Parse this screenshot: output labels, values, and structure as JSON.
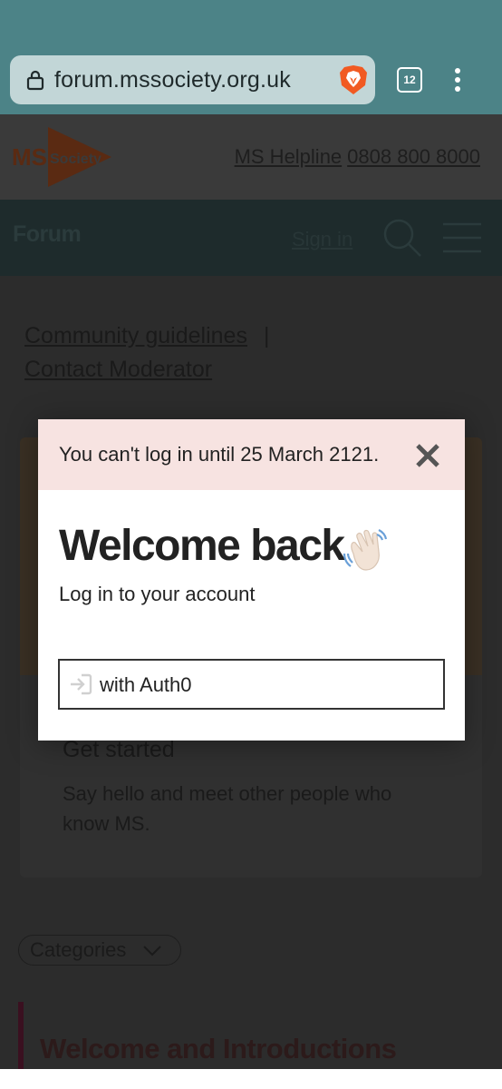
{
  "browser": {
    "url": "forum.mssociety.org.uk",
    "tab_count": "12"
  },
  "site": {
    "logo_text": "MS Society",
    "helpline_label": "MS Helpline",
    "helpline_number": "0808 800 8000",
    "forum_title": "Forum",
    "signin_label": "Sign in"
  },
  "page": {
    "community_guidelines": "Community guidelines",
    "separator": "|",
    "contact_moderator": "Contact Moderator",
    "card_title": "Get started",
    "card_description": "Say hello and meet other people who know MS.",
    "categories_label": "Categories",
    "section_title": "Welcome and Introductions"
  },
  "modal": {
    "alert_message": "You can't log in until 25 March 2121.",
    "title": "Welcome back",
    "subtitle": "Log in to your account",
    "auth_button_label": "with Auth0"
  },
  "colors": {
    "browser_bar": "#4c8387",
    "alert_bg": "#f7e3e1",
    "ms_orange": "#e8591a"
  }
}
